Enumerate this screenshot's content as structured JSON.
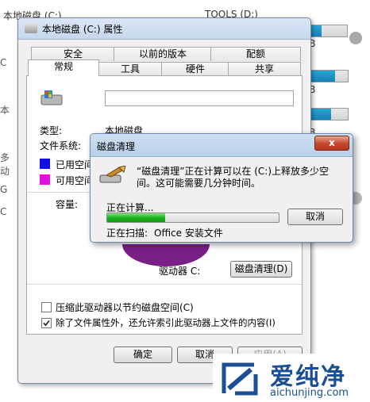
{
  "background": {
    "drive_c_label": "本地磁盘 (C:)",
    "drive_d_label": "TOOLS (D:)",
    "gb_1": "GB",
    "gb_2": "GB",
    "gb_3": "GB",
    "side_fragments": [
      "C",
      "本",
      "多动",
      "G",
      "C"
    ]
  },
  "properties": {
    "title": "本地磁盘 (C:) 属性",
    "tabs_row1": [
      "安全",
      "以前的版本",
      "配额"
    ],
    "tabs_row2": [
      "常规",
      "工具",
      "硬件",
      "共享"
    ],
    "type_label": "类型:",
    "type_value": "本地磁盘",
    "fs_label": "文件系统:",
    "used_label": "已用空间",
    "free_label": "可用空间",
    "capacity_label": "容量:",
    "drive_label": "驱动器 C:",
    "cleanup_button": "磁盘清理(D)",
    "compress_label": "压缩此驱动器以节约磁盘空间(C)",
    "compress_checked": false,
    "index_label": "除了文件属性外，还允许索引此驱动器上文件的内容(I)",
    "index_checked": true,
    "ok_button": "确定",
    "cancel_button": "取消",
    "apply_button": "应用(A)",
    "colors": {
      "used": "#1010e0",
      "free": "#e010e0"
    }
  },
  "cleanup_dialog": {
    "title": "磁盘清理",
    "message_line1": "“磁盘清理”正在计算可以在 (C:)上释放多少空",
    "message_line2": "间。这可能需要几分钟时间。",
    "calculating": "正在计算...",
    "progress": 0.34,
    "cancel_button": "取消",
    "scanning_label": "正在扫描:",
    "scanning_value": "Office 安装文件",
    "close_symbol": "x"
  },
  "watermark": {
    "brand": "爱纯净",
    "url": "aichunjing.com"
  }
}
